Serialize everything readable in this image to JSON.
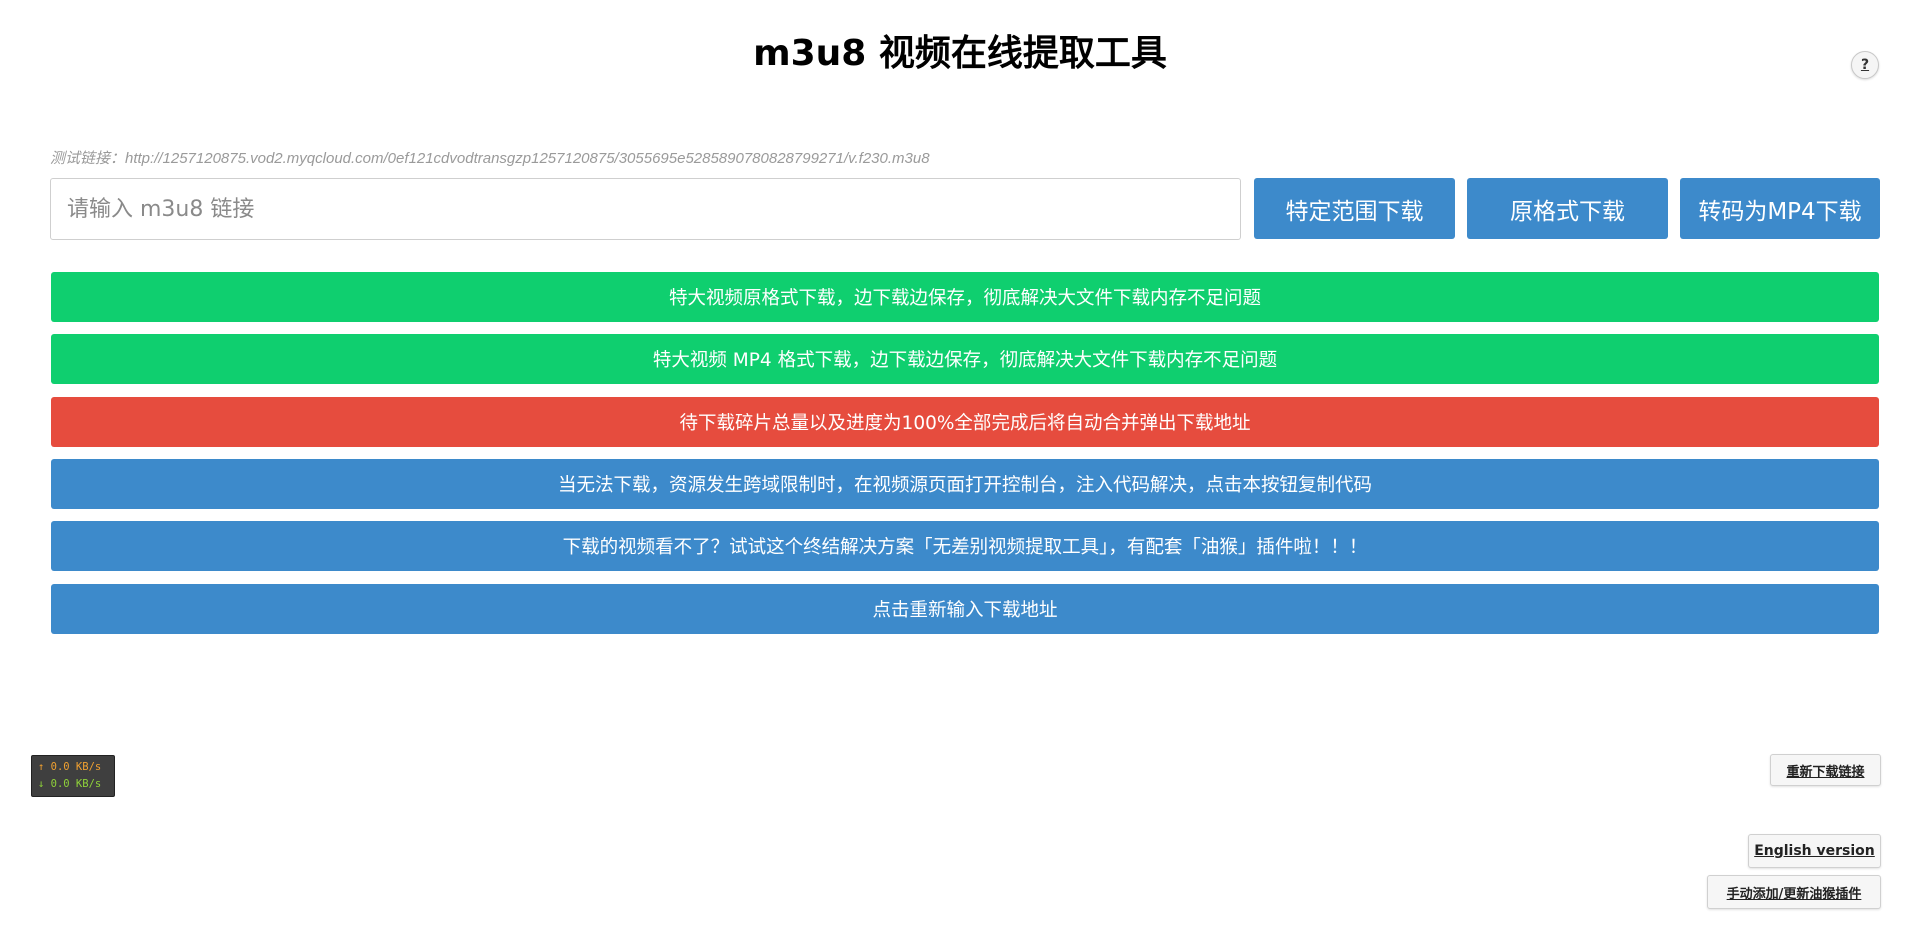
{
  "page": {
    "title": "m3u8 视频在线提取工具",
    "help_label": "?"
  },
  "input": {
    "test_link": "测试链接：http://1257120875.vod2.myqcloud.com/0ef121cdvodtransgzp1257120875/3055695e5285890780828799271/v.f230.m3u8",
    "placeholder": "请输入 m3u8 链接",
    "value": ""
  },
  "buttons": {
    "range_download": "特定范围下载",
    "original_download": "原格式下载",
    "mp4_download": "转码为MP4下载"
  },
  "bars": [
    {
      "label": "特大视频原格式下载，边下载边保存，彻底解决大文件下载内存不足问题",
      "color": "green"
    },
    {
      "label": "特大视频 MP4 格式下载，边下载边保存，彻底解决大文件下载内存不足问题",
      "color": "green"
    },
    {
      "label": "待下载碎片总量以及进度为100%全部完成后将自动合并弹出下载地址",
      "color": "red"
    },
    {
      "label": "当无法下载，资源发生跨域限制时，在视频源页面打开控制台，注入代码解决，点击本按钮复制代码",
      "color": "blue"
    },
    {
      "label": "下载的视频看不了？试试这个终结解决方案「无差别视频提取工具」，有配套「油猴」插件啦！！！",
      "color": "blue"
    },
    {
      "label": "点击重新输入下载地址",
      "color": "blue"
    }
  ],
  "speed_widget": {
    "upload": "↑ 0.0 KB/s",
    "download": "↓ 0.0 KB/s"
  },
  "side_buttons": {
    "redownload_link": "重新下载链接",
    "english_version": "English version",
    "manual_plugin": "手动添加/更新油猴插件"
  },
  "colors": {
    "green": "#0fcf6f",
    "red": "#e64c3e",
    "blue": "#3d8acb"
  }
}
